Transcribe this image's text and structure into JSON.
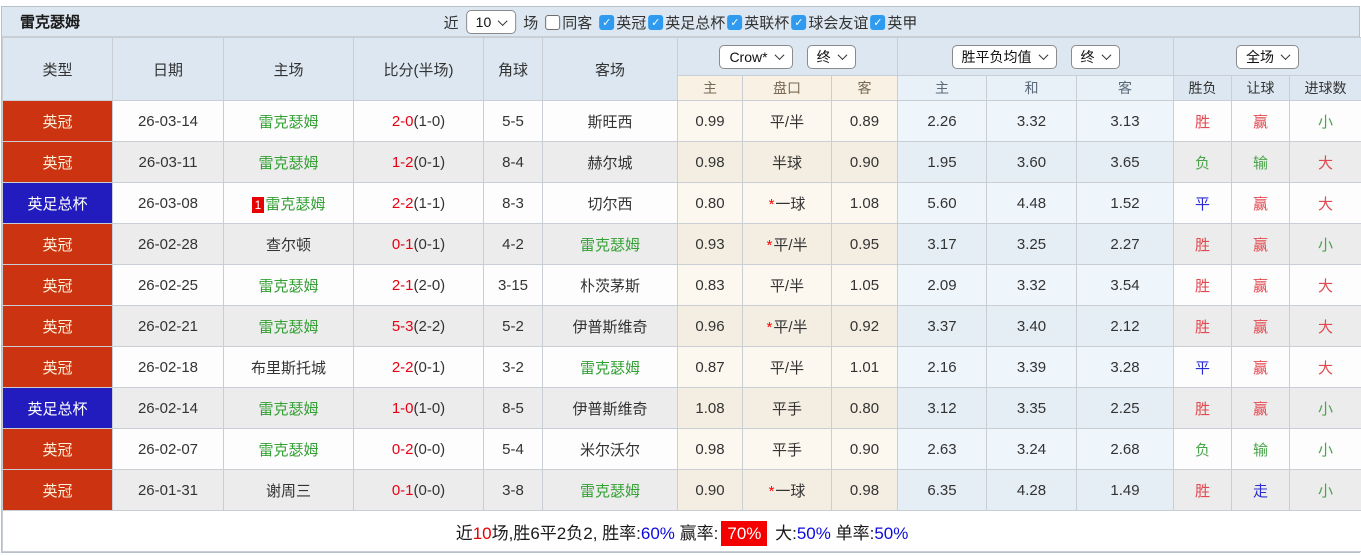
{
  "title": "雷克瑟姆",
  "controls": {
    "near_label": "近",
    "near_count": "10",
    "games_label": "场",
    "same_away": {
      "label": "同客",
      "checked": false
    },
    "leagues": [
      {
        "label": "英冠",
        "checked": true
      },
      {
        "label": "英足总杯",
        "checked": true
      },
      {
        "label": "英联杯",
        "checked": true
      },
      {
        "label": "球会友谊",
        "checked": true
      },
      {
        "label": "英甲",
        "checked": true
      }
    ]
  },
  "table": {
    "columns": {
      "type": "类型",
      "date": "日期",
      "home": "主场",
      "score": "比分(半场)",
      "corner": "角球",
      "away": "客场"
    },
    "selects": {
      "odds_source": "Crow*",
      "odds_time": "终",
      "avg_source": "胜平负均值",
      "avg_time": "终",
      "scope": "全场"
    },
    "subheaders": [
      "主",
      "盘口",
      "客",
      "主",
      "和",
      "客",
      "胜负",
      "让球",
      "进球数"
    ],
    "rows": [
      {
        "type": "英冠",
        "cat": "league",
        "date": "26-03-14",
        "rank": "",
        "home": "雷克瑟姆",
        "home_self": true,
        "score": "2-0",
        "half": "(1-0)",
        "corner": "5-5",
        "away": "斯旺西",
        "away_self": false,
        "odds_home": "0.99",
        "handicap": "平/半",
        "handicap_star": false,
        "odds_away": "0.89",
        "avg": [
          "2.26",
          "3.32",
          "3.13"
        ],
        "result": {
          "text": "胜",
          "tone": "red"
        },
        "handicap_result": {
          "text": "赢",
          "tone": "red"
        },
        "goals_result": {
          "text": "小",
          "tone": "green"
        }
      },
      {
        "type": "英冠",
        "cat": "league",
        "date": "26-03-11",
        "rank": "",
        "home": "雷克瑟姆",
        "home_self": true,
        "score": "1-2",
        "half": "(0-1)",
        "corner": "8-4",
        "away": "赫尔城",
        "away_self": false,
        "odds_home": "0.98",
        "handicap": "半球",
        "handicap_star": false,
        "odds_away": "0.90",
        "avg": [
          "1.95",
          "3.60",
          "3.65"
        ],
        "result": {
          "text": "负",
          "tone": "green"
        },
        "handicap_result": {
          "text": "输",
          "tone": "green"
        },
        "goals_result": {
          "text": "大",
          "tone": "red"
        }
      },
      {
        "type": "英足总杯",
        "cat": "cup",
        "date": "26-03-08",
        "rank": "1",
        "home": "雷克瑟姆",
        "home_self": true,
        "score": "2-2",
        "half": "(1-1)",
        "corner": "8-3",
        "away": "切尔西",
        "away_self": false,
        "odds_home": "0.80",
        "handicap": "一球",
        "handicap_star": true,
        "odds_away": "1.08",
        "avg": [
          "5.60",
          "4.48",
          "1.52"
        ],
        "result": {
          "text": "平",
          "tone": "blue"
        },
        "handicap_result": {
          "text": "赢",
          "tone": "red"
        },
        "goals_result": {
          "text": "大",
          "tone": "red"
        }
      },
      {
        "type": "英冠",
        "cat": "league",
        "date": "26-02-28",
        "rank": "",
        "home": "查尔顿",
        "home_self": false,
        "score": "0-1",
        "half": "(0-1)",
        "corner": "4-2",
        "away": "雷克瑟姆",
        "away_self": true,
        "odds_home": "0.93",
        "handicap": "平/半",
        "handicap_star": true,
        "odds_away": "0.95",
        "avg": [
          "3.17",
          "3.25",
          "2.27"
        ],
        "result": {
          "text": "胜",
          "tone": "red"
        },
        "handicap_result": {
          "text": "赢",
          "tone": "red"
        },
        "goals_result": {
          "text": "小",
          "tone": "green"
        }
      },
      {
        "type": "英冠",
        "cat": "league",
        "date": "26-02-25",
        "rank": "",
        "home": "雷克瑟姆",
        "home_self": true,
        "score": "2-1",
        "half": "(2-0)",
        "corner": "3-15",
        "away": "朴茨茅斯",
        "away_self": false,
        "odds_home": "0.83",
        "handicap": "平/半",
        "handicap_star": false,
        "odds_away": "1.05",
        "avg": [
          "2.09",
          "3.32",
          "3.54"
        ],
        "result": {
          "text": "胜",
          "tone": "red"
        },
        "handicap_result": {
          "text": "赢",
          "tone": "red"
        },
        "goals_result": {
          "text": "大",
          "tone": "red"
        }
      },
      {
        "type": "英冠",
        "cat": "league",
        "date": "26-02-21",
        "rank": "",
        "home": "雷克瑟姆",
        "home_self": true,
        "score": "5-3",
        "half": "(2-2)",
        "corner": "5-2",
        "away": "伊普斯维奇",
        "away_self": false,
        "odds_home": "0.96",
        "handicap": "平/半",
        "handicap_star": true,
        "odds_away": "0.92",
        "avg": [
          "3.37",
          "3.40",
          "2.12"
        ],
        "result": {
          "text": "胜",
          "tone": "red"
        },
        "handicap_result": {
          "text": "赢",
          "tone": "red"
        },
        "goals_result": {
          "text": "大",
          "tone": "red"
        }
      },
      {
        "type": "英冠",
        "cat": "league",
        "date": "26-02-18",
        "rank": "",
        "home": "布里斯托城",
        "home_self": false,
        "score": "2-2",
        "half": "(0-1)",
        "corner": "3-2",
        "away": "雷克瑟姆",
        "away_self": true,
        "odds_home": "0.87",
        "handicap": "平/半",
        "handicap_star": false,
        "odds_away": "1.01",
        "avg": [
          "2.16",
          "3.39",
          "3.28"
        ],
        "result": {
          "text": "平",
          "tone": "blue"
        },
        "handicap_result": {
          "text": "赢",
          "tone": "red"
        },
        "goals_result": {
          "text": "大",
          "tone": "red"
        }
      },
      {
        "type": "英足总杯",
        "cat": "cup",
        "date": "26-02-14",
        "rank": "",
        "home": "雷克瑟姆",
        "home_self": true,
        "score": "1-0",
        "half": "(1-0)",
        "corner": "8-5",
        "away": "伊普斯维奇",
        "away_self": false,
        "odds_home": "1.08",
        "handicap": "平手",
        "handicap_star": false,
        "odds_away": "0.80",
        "avg": [
          "3.12",
          "3.35",
          "2.25"
        ],
        "result": {
          "text": "胜",
          "tone": "red"
        },
        "handicap_result": {
          "text": "赢",
          "tone": "red"
        },
        "goals_result": {
          "text": "小",
          "tone": "green"
        }
      },
      {
        "type": "英冠",
        "cat": "league",
        "date": "26-02-07",
        "rank": "",
        "home": "雷克瑟姆",
        "home_self": true,
        "score": "0-2",
        "half": "(0-0)",
        "corner": "5-4",
        "away": "米尔沃尔",
        "away_self": false,
        "odds_home": "0.98",
        "handicap": "平手",
        "handicap_star": false,
        "odds_away": "0.90",
        "avg": [
          "2.63",
          "3.24",
          "2.68"
        ],
        "result": {
          "text": "负",
          "tone": "green"
        },
        "handicap_result": {
          "text": "输",
          "tone": "green"
        },
        "goals_result": {
          "text": "小",
          "tone": "green"
        }
      },
      {
        "type": "英冠",
        "cat": "league",
        "date": "26-01-31",
        "rank": "",
        "home": "谢周三",
        "home_self": false,
        "score": "0-1",
        "half": "(0-0)",
        "corner": "3-8",
        "away": "雷克瑟姆",
        "away_self": true,
        "odds_home": "0.90",
        "handicap": "一球",
        "handicap_star": true,
        "odds_away": "0.98",
        "avg": [
          "6.35",
          "4.28",
          "1.49"
        ],
        "result": {
          "text": "胜",
          "tone": "red"
        },
        "handicap_result": {
          "text": "走",
          "tone": "blue"
        },
        "goals_result": {
          "text": "小",
          "tone": "green"
        }
      }
    ]
  },
  "footer": {
    "segments": [
      {
        "text": "近",
        "style": "plain"
      },
      {
        "text": "10",
        "style": "red"
      },
      {
        "text": "场,胜6平2负2, 胜率:",
        "style": "plain"
      },
      {
        "text": "60%",
        "style": "blue"
      },
      {
        "text": " 赢率:",
        "style": "plain"
      },
      {
        "text": "70%",
        "style": "redbg"
      },
      {
        "text": " 大:",
        "style": "plain"
      },
      {
        "text": "50%",
        "style": "blue"
      },
      {
        "text": " 单率:",
        "style": "plain"
      },
      {
        "text": "50%",
        "style": "blue"
      }
    ]
  }
}
